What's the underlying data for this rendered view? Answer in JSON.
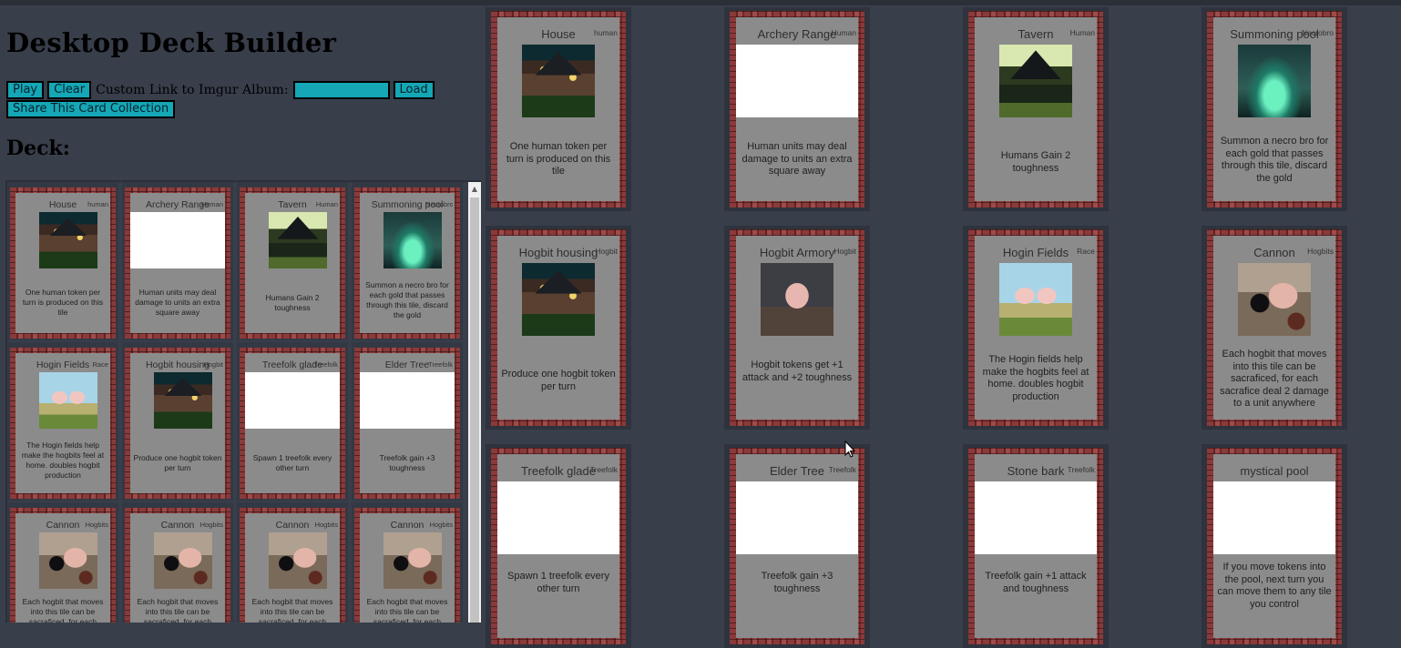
{
  "app": {
    "title": "Desktop Deck Builder",
    "play_label": "Play",
    "clear_label": "Clear",
    "custom_link_label": "Custom Link to Imgur Album:",
    "album_input_value": "",
    "load_label": "Load",
    "share_label": "Share This Card Collection",
    "deck_heading": "Deck:"
  },
  "colors": {
    "background": "#383e4a",
    "button": "#15a7b6",
    "card_face": "#8b8b8b"
  },
  "deck": [
    {
      "name": "House",
      "type": "human",
      "art": "house",
      "text": "One human token per turn is produced on this tile"
    },
    {
      "name": "Archery Range",
      "type": "Human",
      "art": "blank",
      "text": "Human units may deal damage to units an extra square away"
    },
    {
      "name": "Tavern",
      "type": "Human",
      "art": "tavern",
      "text": "Humans Gain 2 toughness"
    },
    {
      "name": "Summoning pool",
      "type": "Necrobro",
      "art": "summon",
      "text": "Summon a necro bro for each gold that passes through this tile, discard the gold"
    },
    {
      "name": "Hogin Fields",
      "type": "Race",
      "art": "field",
      "text": "The Hogin fields help make the hogbits feel at home. doubles hogbit production"
    },
    {
      "name": "Hogbit housing",
      "type": "Hogbit",
      "art": "house",
      "text": "Produce one hogbit token per turn"
    },
    {
      "name": "Treefolk glade",
      "type": "Treefolk",
      "art": "blank",
      "text": "Spawn 1 treefolk every other turn"
    },
    {
      "name": "Elder Tree",
      "type": "Treefolk",
      "art": "blank",
      "text": "Treefolk gain +3 toughness"
    },
    {
      "name": "Cannon",
      "type": "Hogbits",
      "art": "cannon",
      "text": "Each hogbit that moves into this tile can be sacraficed, for each"
    },
    {
      "name": "Cannon",
      "type": "Hogbits",
      "art": "cannon",
      "text": "Each hogbit that moves into this tile can be sacraficed, for each"
    },
    {
      "name": "Cannon",
      "type": "Hogbits",
      "art": "cannon",
      "text": "Each hogbit that moves into this tile can be sacraficed, for each"
    },
    {
      "name": "Cannon",
      "type": "Hogbits",
      "art": "cannon",
      "text": "Each hogbit that moves into this tile can be sacraficed, for each"
    }
  ],
  "collection": [
    {
      "name": "House",
      "type": "human",
      "art": "house",
      "text": "One human token per turn is produced on this tile"
    },
    {
      "name": "Archery Range",
      "type": "Human",
      "art": "blank",
      "text": "Human units may deal damage to units an extra square away"
    },
    {
      "name": "Tavern",
      "type": "Human",
      "art": "tavern",
      "text": "Humans Gain 2 toughness"
    },
    {
      "name": "Summoning pool",
      "type": "Necrobro",
      "art": "summon",
      "text": "Summon a necro bro for each gold that passes through this tile, discard the gold"
    },
    {
      "name": "Hogbit housing",
      "type": "Hogbit",
      "art": "house",
      "text": "Produce one hogbit token per turn"
    },
    {
      "name": "Hogbit Armory",
      "type": "Hogbit",
      "art": "pig",
      "text": "Hogbit tokens get +1 attack and +2 toughness"
    },
    {
      "name": "Hogin Fields",
      "type": "Race",
      "art": "field",
      "text": "The Hogin fields help make the hogbits feel at home. doubles hogbit production"
    },
    {
      "name": "Cannon",
      "type": "Hogbits",
      "art": "cannon",
      "text": "Each hogbit that moves into this tile can be sacraficed, for each sacrafice deal 2 damage to a unit anywhere"
    },
    {
      "name": "Treefolk glade",
      "type": "Treefolk",
      "art": "blank",
      "text": "Spawn 1 treefolk every other turn"
    },
    {
      "name": "Elder Tree",
      "type": "Treefolk",
      "art": "blank",
      "text": "Treefolk gain +3 toughness"
    },
    {
      "name": "Stone bark",
      "type": "Treefolk",
      "art": "blank",
      "text": "Treefolk gain +1 attack and toughness"
    },
    {
      "name": "mystical pool",
      "type": "",
      "art": "blank",
      "text": "If you move tokens into the pool, next turn you can move them to any tile you control"
    }
  ]
}
